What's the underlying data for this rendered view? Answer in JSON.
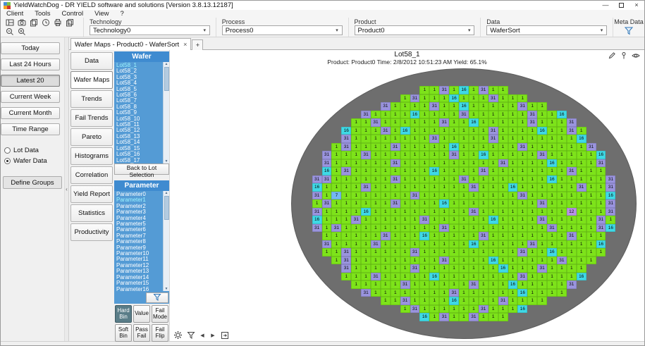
{
  "window": {
    "title": "YieldWatchDog - DR YIELD software and solutions [Version 3.8.13.12187]",
    "minimize_glyph": "—",
    "close_glyph": "×"
  },
  "menubar": {
    "items": [
      "Client",
      "Tools",
      "Control",
      "View",
      "?"
    ]
  },
  "toolbar": {
    "icons": [
      "window-layout-icon",
      "camera-icon",
      "copy-icon",
      "history-icon",
      "printer-icon",
      "duplicate-icon",
      "zoom-out-icon",
      "zoom-in-icon"
    ],
    "filters": [
      {
        "label": "Technology",
        "value": "Technology0"
      },
      {
        "label": "Process",
        "value": "Process0"
      },
      {
        "label": "Product",
        "value": "Product0"
      },
      {
        "label": "Data",
        "value": "WaferSort"
      }
    ],
    "meta": {
      "label": "Meta Data",
      "icon": "filter-funnel-icon"
    }
  },
  "tabstrip": {
    "active_tab": "Wafer Maps - Product0 - WaferSort",
    "close_glyph": "×",
    "add_glyph": "+"
  },
  "sidebar": {
    "time_buttons": [
      {
        "label": "Today",
        "selected": false
      },
      {
        "label": "Last 24 Hours",
        "selected": false
      },
      {
        "label": "Latest 20",
        "selected": true
      },
      {
        "label": "Current Week",
        "selected": false
      },
      {
        "label": "Current Month",
        "selected": false
      },
      {
        "label": "Time Range",
        "selected": false
      }
    ],
    "radios": [
      {
        "label": "Lot Data",
        "selected": false
      },
      {
        "label": "Wafer Data",
        "selected": true
      }
    ],
    "define_groups": "Define Groups",
    "collapse_glyph": "‹"
  },
  "view_tabs": {
    "items": [
      {
        "label": "Data",
        "active": false
      },
      {
        "label": "Wafer Maps",
        "active": true
      },
      {
        "label": "Trends",
        "active": false
      },
      {
        "label": "Fail Trends",
        "active": false
      },
      {
        "label": "Pareto",
        "active": false
      },
      {
        "label": "Histograms",
        "active": false
      },
      {
        "label": "Correlation",
        "active": false
      },
      {
        "label": "Yield Report",
        "active": false
      },
      {
        "label": "Statistics",
        "active": false
      },
      {
        "label": "Productivity",
        "active": false
      }
    ]
  },
  "wafer_panel": {
    "header": "Wafer",
    "items": [
      "Lot58_1",
      "Lot58_2",
      "Lot58_3",
      "Lot58_4",
      "Lot58_5",
      "Lot58_6",
      "Lot58_7",
      "Lot58_8",
      "Lot58_9",
      "Lot58_10",
      "Lot58_11",
      "Lot58_12",
      "Lot58_13",
      "Lot58_14",
      "Lot58_15",
      "Lot58_16",
      "Lot58_17"
    ],
    "selected": "Lot58_1",
    "back_button": "Back to Lot Selection"
  },
  "parameter_panel": {
    "header": "Parameter",
    "items": [
      "Parameter0",
      "Parameter1",
      "Parameter2",
      "Parameter3",
      "Parameter4",
      "Parameter5",
      "Parameter6",
      "Parameter7",
      "Parameter8",
      "Parameter9",
      "Parameter10",
      "Parameter11",
      "Parameter12",
      "Parameter13",
      "Parameter14",
      "Parameter15",
      "Parameter16"
    ],
    "selected": "Parameter1",
    "filter_icon": "filter-funnel-icon",
    "mode_buttons": [
      {
        "label": "Hard Bin",
        "active": true
      },
      {
        "label": "Value",
        "active": false
      },
      {
        "label": "Fail Mode",
        "active": false
      },
      {
        "label": "Soft Bin",
        "active": false
      },
      {
        "label": "Pass Fail",
        "active": false
      },
      {
        "label": "Fail Flip",
        "active": false
      }
    ]
  },
  "map": {
    "title": "Lot58_1",
    "subtitle": "Product: Product0 Time: 2/8/2012 10:51:23 AM Yield: 65.1%",
    "wafer_color": "#6e6e6e",
    "tools_top": [
      "edit-pencil-icon",
      "pin-icon",
      "eye-icon"
    ],
    "tools_bottom": [
      "settings-gear-icon",
      "filter-funnel-icon",
      "prev-arrow",
      "next-arrow",
      "export-icon"
    ],
    "prev_glyph": "◀",
    "next_glyph": "▶",
    "legend": {
      "G": {
        "value": "1",
        "color": "#7de31a"
      },
      "P": {
        "value": "31",
        "color": "#9a94de"
      },
      "C": {
        "value": "16",
        "color": "#3fd9e6"
      },
      "B": {
        "value": "7",
        "color": "#74b8f2"
      },
      "V": {
        "value": "12",
        "color": "#b892e8"
      }
    },
    "rows": [
      "GGPGCGPGG",
      "GPGGGCGGGPGGG",
      "PGGGGPGGCGGGGGPGG",
      "PGGGGCGGGGPGGGGGGPGGC",
      "GGPGGGGGGPGGCGGGGGPGGGP",
      "CGGGPGCGGGGGGGGPGGGGCGGPG",
      "PGGGGGGGGPGGGGGPGGGGGGGGC",
      "GPGGGGPGGGGGCGGGGGGPGGGGGGP",
      "PGGGPGGGGGGGGPGGCGGGGGPGGGGGC",
      "PGGGGGGPGGGGGGGGGGPGGGGCGGGGP",
      "CGPGGGGGGGGCGGGGPGGGGGGGGPGGG",
      "PPGGGGGGPGGGGGGPGGGGGGGGCGGGGGP",
      "CGGGGPGGGGGGGGGGPGGGCGGGGGGPGGP",
      "PGBGGGGGGGPGGGGGGGGGGPGGGGGGGGC",
      "GPGGGGGGPGGGGCGGGGGGGGGPGGGGGGP",
      "PGGGGCGGGGGGGGGGPGGGGGGGGGVGGGP",
      "CGGGPGGGGGGPGGGGGGCGGGGPGGGGGPG",
      "PGPGGGGGGGGGGPGGGGGGGGGGPGGGGPC",
      "GGGGGGPGGGCGGGGGPGGGGGGGGPGGG",
      "PGGGGPGGGGGGGGGCGGGGGPGGGGGGC",
      "GGPGGGGGGPGGGGGGGGGGPGGCGGGGG",
      "GPGGGGGGGGGPGGGGCGGGGGGPGGG",
      "PGGGGGGPGGGGGGGGCGGGPGGGG",
      "GGGPGGGGGCGGGGGGGGPGGGGGC",
      "GGGGGPGGGGGGPGGGCGGGGGP",
      "PGGGGGGGGPGGGGGGCGGGG",
      "GGPGGGGCGGGGPGGGG",
      "GPGGGGGGPGGGC",
      "CGPGGPGGG"
    ]
  }
}
